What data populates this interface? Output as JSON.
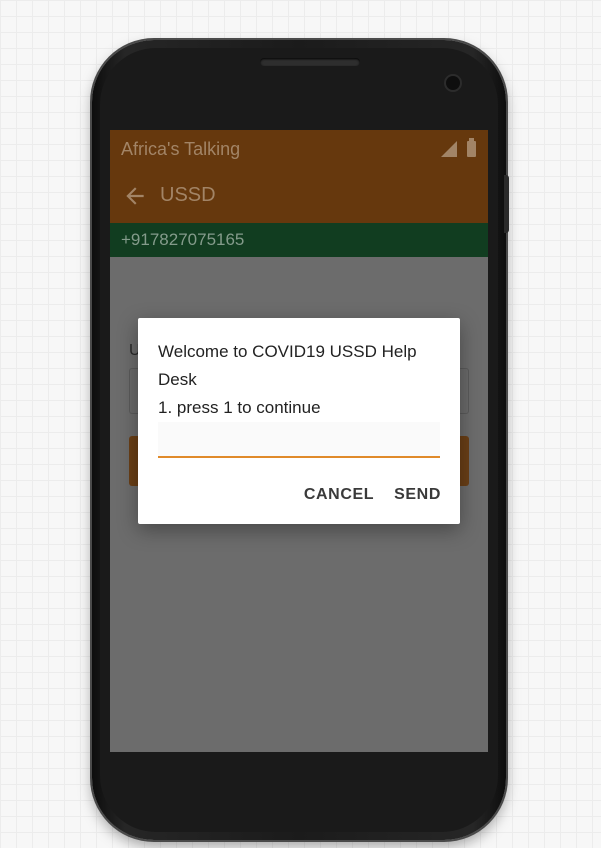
{
  "status_bar": {
    "title": "Africa's Talking"
  },
  "app_bar": {
    "title": "USSD"
  },
  "phone_number": "+917827075165",
  "form": {
    "label_initial": "U"
  },
  "dialog": {
    "message": "Welcome to COVID19 USSD Help Desk\n1. press 1 to continue",
    "input_value": "",
    "cancel_label": "CANCEL",
    "send_label": "SEND"
  },
  "colors": {
    "app_bar": "#66380d",
    "phone_bar": "#113d20",
    "overlay": "#6c6c6c",
    "accent": "#e08a2a"
  },
  "icons": [
    "signal-icon",
    "battery-icon",
    "back-arrow-icon"
  ]
}
